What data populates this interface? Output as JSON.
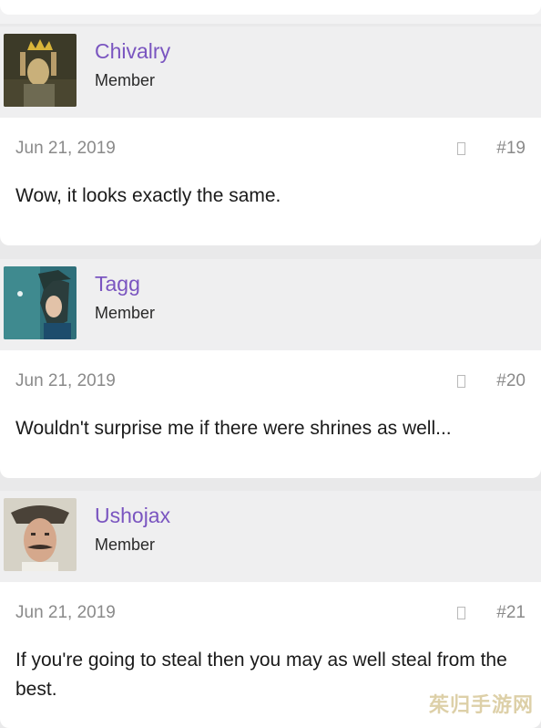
{
  "posts": [
    {
      "username": "Chivalry",
      "role": "Member",
      "avatar_icon": "knight-crown-avatar",
      "date": "Jun 21, 2019",
      "number": "#19",
      "text": "Wow, it looks exactly the same."
    },
    {
      "username": "Tagg",
      "role": "Member",
      "avatar_icon": "anime-character-avatar",
      "date": "Jun 21, 2019",
      "number": "#20",
      "text": "Wouldn't surprise me if there were shrines as well..."
    },
    {
      "username": "Ushojax",
      "role": "Member",
      "avatar_icon": "mustache-man-avatar",
      "date": "Jun 21, 2019",
      "number": "#21",
      "text": "If you're going to steal then you may as well steal from the best."
    }
  ],
  "watermark": "茱归手游网",
  "colors": {
    "username": "#7a55c0",
    "header_bg": "#efeff0",
    "meta_text": "#8a8a8a"
  }
}
